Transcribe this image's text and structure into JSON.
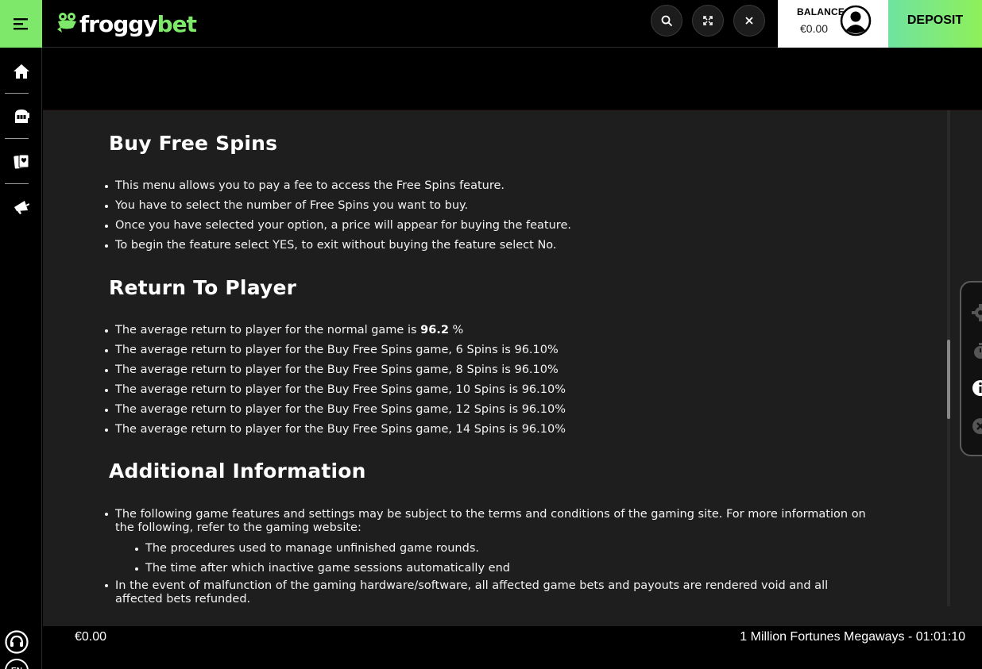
{
  "header": {
    "logo_text_primary": "froggy",
    "logo_text_accent": "bet",
    "balance_label": "BALANCE",
    "balance_amount": "€0.00",
    "deposit_label": "DEPOSIT"
  },
  "sidebar": {
    "language_code": "EN"
  },
  "sections": {
    "buy_free_spins": {
      "title": "Buy Free Spins",
      "items": [
        "This menu allows you to pay a fee to access the Free Spins feature.",
        "You have to select the number of Free Spins you want to buy.",
        "Once you have selected your option, a price will appear for buying the feature.",
        "To begin the feature select YES, to exit without buying the feature select No."
      ]
    },
    "return_to_player": {
      "title": "Return To Player",
      "first_item_prefix": "The average return to player for the normal game is ",
      "first_item_value": "96.2",
      "first_item_suffix": " %",
      "items": [
        "The average return to player for the Buy Free Spins game, 6 Spins is 96.10%",
        "The average return to player for the Buy Free Spins game, 8 Spins is 96.10%",
        "The average return to player for the Buy Free Spins game, 10 Spins is 96.10%",
        "The average return to player for the Buy Free Spins game, 12 Spins is 96.10%",
        "The average return to player for the Buy Free Spins game, 14 Spins is 96.10%"
      ]
    },
    "additional_information": {
      "title": "Additional Information",
      "items": [
        "The following game features and settings may be subject to the terms and conditions of the gaming site. For more information on the following, refer to the gaming website:",
        "In the event of malfunction of the gaming hardware/software, all affected game bets and payouts are rendered void and all affected bets refunded."
      ],
      "sub_items": [
        "The procedures used to manage unfinished game rounds.",
        "The time after which inactive game sessions automatically end"
      ]
    }
  },
  "footer": {
    "balance": "€0.00",
    "game_title_time": "1 Million Fortunes Megaways - 01:01:10"
  },
  "colors": {
    "accent_green": "#7de86a",
    "content_bg": "#1e1e1e",
    "topbar_bg": "#000000"
  },
  "icons": {
    "menu": "hamburger-icon",
    "search": "search-icon",
    "fullscreen": "fullscreen-icon",
    "close": "close-icon",
    "avatar": "user-avatar-icon",
    "home": "home-icon",
    "slots": "slot-machine-icon",
    "cards": "cards-icon",
    "promotions": "megaphone-icon",
    "support": "headset-icon",
    "settings": "gear-icon",
    "timer": "stopwatch-icon",
    "info": "info-icon",
    "close_panel": "close-circle-icon"
  }
}
